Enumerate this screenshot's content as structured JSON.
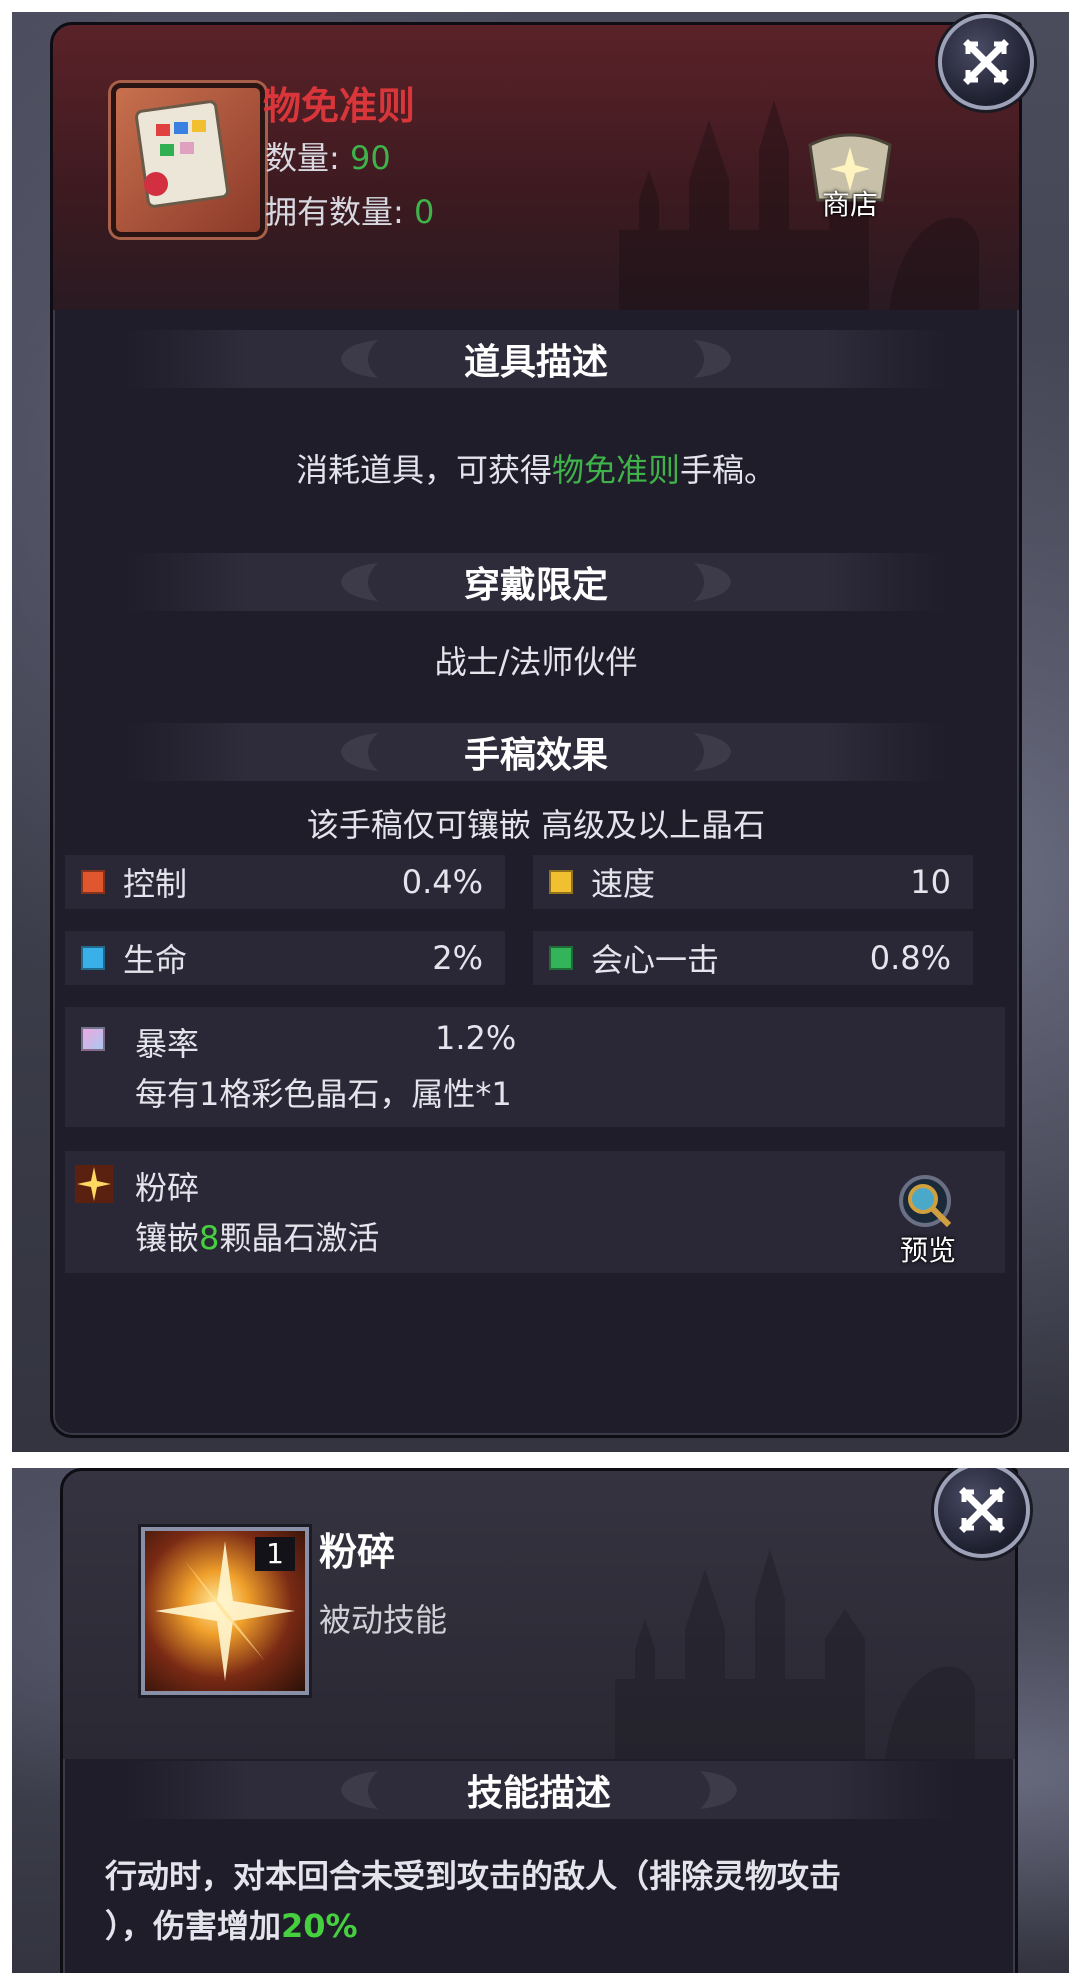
{
  "item": {
    "name": "物免准则",
    "quantity_label": "数量:",
    "quantity_value": "90",
    "owned_label": "拥有数量:",
    "owned_value": "0",
    "shop_label": "商店"
  },
  "description": {
    "header": "道具描述",
    "prefix": "消耗道具，可获得",
    "highlight": "物免准则",
    "suffix": "手稿。"
  },
  "wear_limit": {
    "header": "穿戴限定",
    "value": "战士/法师伙伴"
  },
  "manuscript_effect": {
    "header": "手稿效果",
    "note": "该手稿仅可镶嵌 高级及以上晶石",
    "stats": [
      {
        "name": "控制",
        "value": "0.4%",
        "gem_color": "#e0562e"
      },
      {
        "name": "速度",
        "value": "10",
        "gem_color": "#f0c030"
      },
      {
        "name": "生命",
        "value": "2%",
        "gem_color": "#3ab0e8"
      },
      {
        "name": "会心一击",
        "value": "0.8%",
        "gem_color": "#34b45a"
      }
    ],
    "crit": {
      "name": "暴率",
      "value": "1.2%",
      "note": "每有1格彩色晶石，属性*1",
      "gem_color": "#c8a8f0"
    },
    "shatter": {
      "name": "粉碎",
      "prefix": "镶嵌",
      "count": "8",
      "suffix": "颗晶石激活",
      "preview_label": "预览"
    }
  },
  "skill": {
    "name": "粉碎",
    "level": "1",
    "type": "被动技能",
    "desc_header": "技能描述",
    "desc_line1": "行动时，对本回合未受到攻击的敌人（排除灵物攻击",
    "desc_line2_prefix": "），伤害增加",
    "desc_line2_value": "20%"
  }
}
